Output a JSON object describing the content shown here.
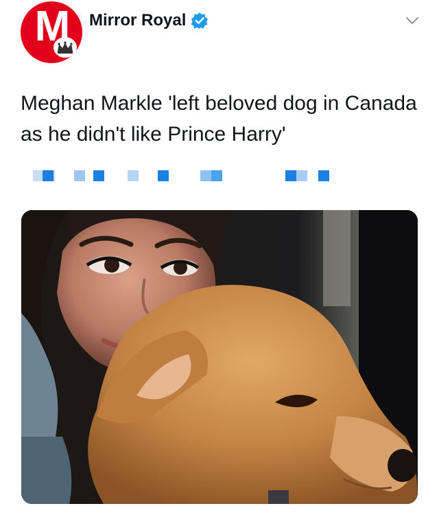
{
  "account": {
    "name": "Mirror Royal",
    "avatar_letter": "M",
    "avatar_color": "#e3001b",
    "verified_color": "#1d9bf0"
  },
  "icons": {
    "verified": "verified-badge-icon",
    "menu": "chevron-down-icon",
    "avatar_crown": "crown-icon"
  },
  "tweet": {
    "text": "Meghan Markle 'left beloved dog in Canada as he didn't like Prince Harry'"
  },
  "colors": {
    "text": "#111418",
    "link_blur": "#1d9bf0"
  }
}
